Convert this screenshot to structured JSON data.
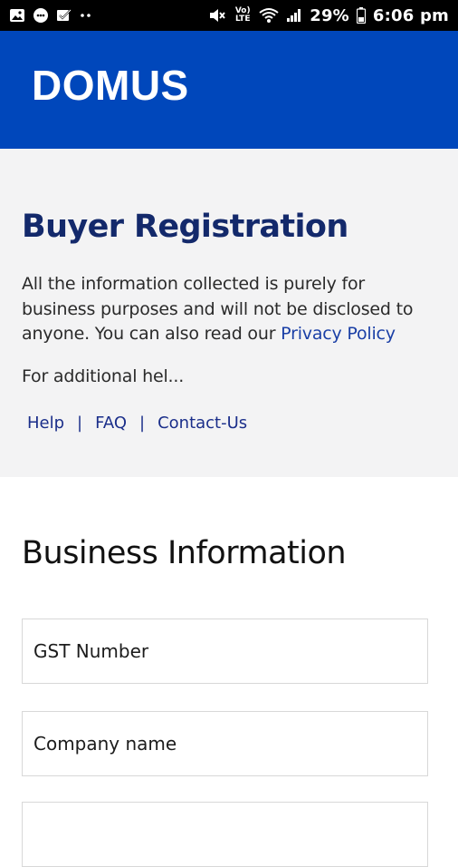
{
  "status_bar": {
    "battery": "29%",
    "time": "6:06 pm",
    "volte_label": "Vo) LTE",
    "icons": [
      "image-icon",
      "messenger-icon",
      "checkbox-icon",
      "more-dots-icon",
      "mute-icon",
      "volte-icon",
      "wifi-icon",
      "signal-icon",
      "battery-icon"
    ]
  },
  "header": {
    "logo": "DOMUS",
    "background": "#0047bb"
  },
  "intro": {
    "title": "Buyer Registration",
    "text": "All the information collected is purely for business purposes and will not be disclosed to anyone. You can also read our ",
    "privacy_link": "Privacy Policy",
    "help_more": "For additional hel...",
    "links": {
      "help": "Help",
      "faq": "FAQ",
      "contact": "Contact-Us",
      "separator": "|"
    }
  },
  "form": {
    "section_title": "Business Information",
    "fields": {
      "gst_placeholder": "GST Number",
      "company_placeholder": "Company name",
      "third_placeholder": ""
    }
  },
  "colors": {
    "brand_blue": "#0047bb",
    "title_navy": "#13296b",
    "link_blue": "#1a3fa6",
    "intro_bg": "#f3f3f4"
  }
}
